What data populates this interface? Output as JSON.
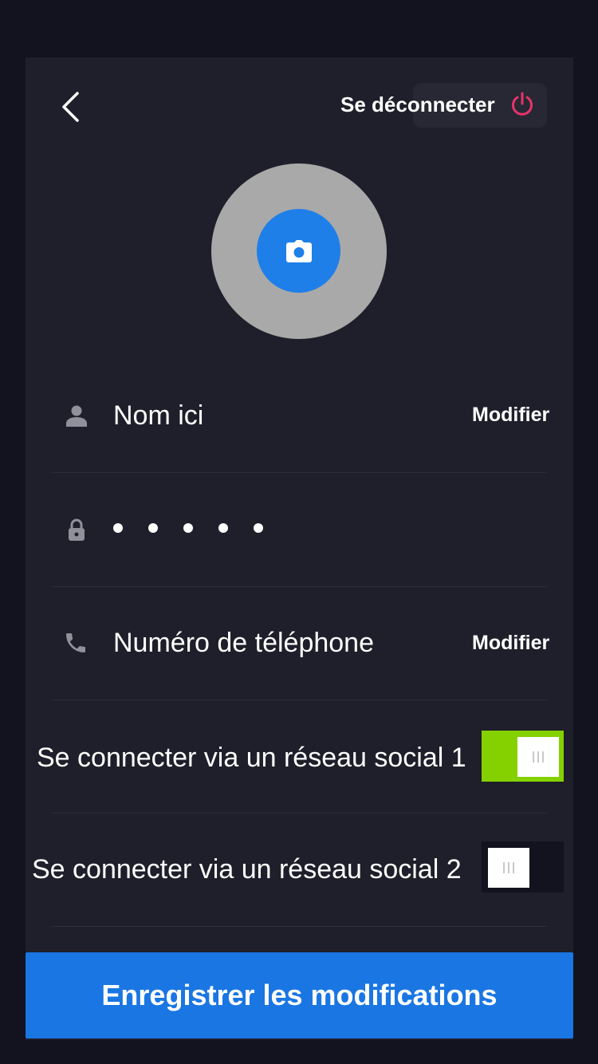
{
  "header": {
    "back_icon": "chevron-left-icon",
    "logout_label": "Se déconnecter",
    "logout_icon": "power-icon",
    "logout_icon_color": "#e8336b"
  },
  "avatar": {
    "camera_icon": "camera-icon",
    "camera_bg": "#1f7fe8",
    "placeholder_bg": "#a9a9a9"
  },
  "fields": {
    "name": {
      "icon": "person-icon",
      "value": "Nom ici",
      "action": "Modifier"
    },
    "password": {
      "icon": "lock-icon",
      "masked_length": 5
    },
    "phone": {
      "icon": "phone-icon",
      "value": "Numéro de téléphone",
      "action": "Modifier"
    }
  },
  "social": [
    {
      "label": "Se connecter via un réseau social 1",
      "enabled": true,
      "color": "#85d100"
    },
    {
      "label": "Se connecter via un réseau social 2",
      "enabled": false
    }
  ],
  "save_label": "Enregistrer les modifications",
  "colors": {
    "accent": "#1a76e3",
    "background": "#12131f",
    "card": "#1e1f2a"
  }
}
